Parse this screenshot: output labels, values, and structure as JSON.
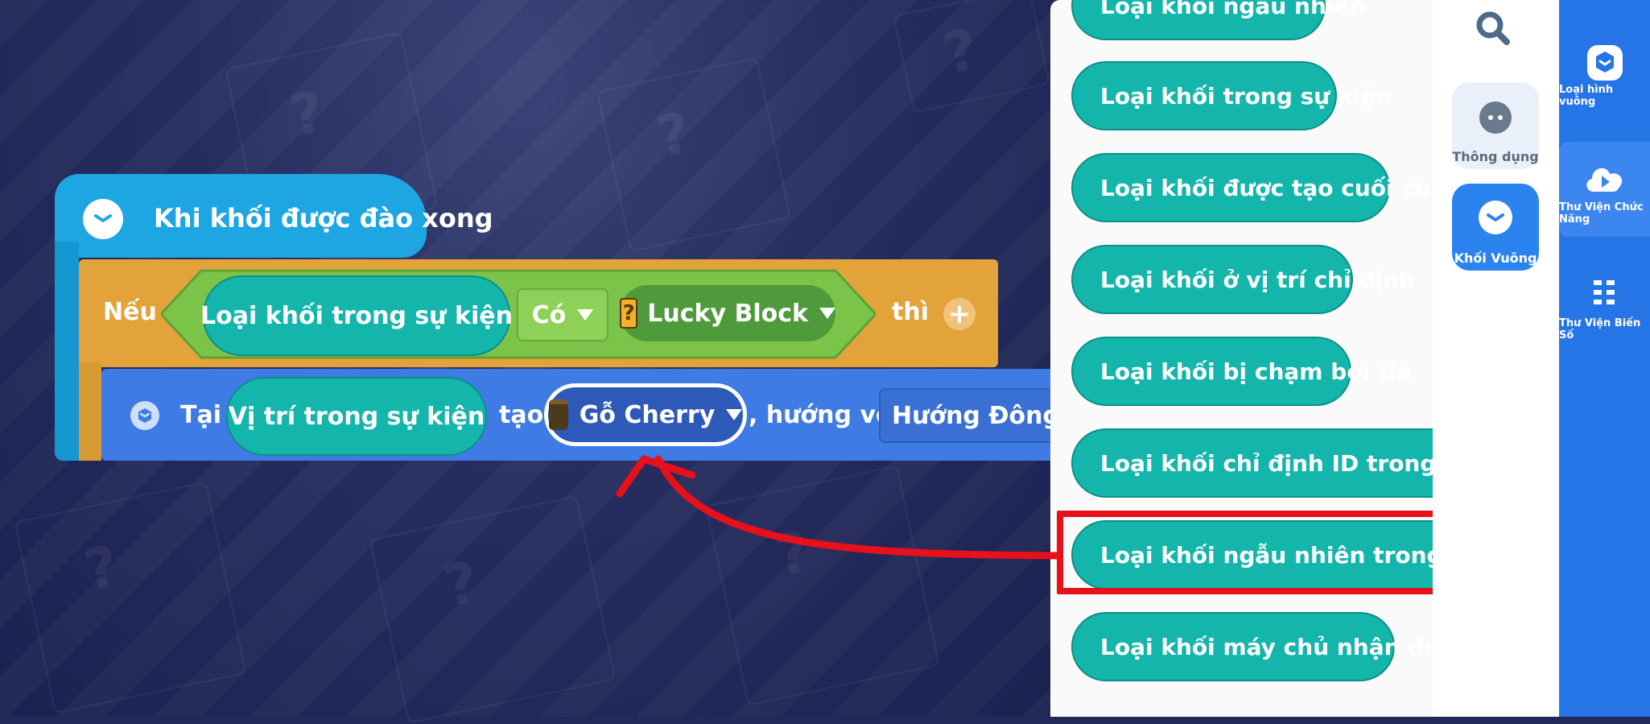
{
  "script": {
    "event_title": "Khi khối được đào xong",
    "if_label": "Nếu",
    "then_label": "thì",
    "plus_symbol": "+",
    "condition": {
      "left_reporter": "Loại khối trong sự kiện",
      "operator": "Có",
      "right_value": "Lucky Block",
      "right_icon": "question-block-icon"
    },
    "action": {
      "at_label": "Tại",
      "position_reporter": "Vị trí trong sự kiện",
      "create_label": "tạo",
      "block_value": "Gỗ Cherry",
      "block_icon": "cherry-log-icon",
      "facing_label": ", hướng về",
      "facing_value": "Hướng Đông"
    }
  },
  "palette": {
    "items": [
      "Loại khối ngẫu nhiên",
      "Loại khối trong sự kiện",
      "Loại khối được tạo cuối cùng",
      "Loại khối ở vị trí chỉ định",
      "Loại khối bị chạm bởi tia",
      "Loại khối chỉ định ID trong nhóm loạ",
      "Loại khối ngẫu nhiên trong nhóm loạ",
      "Loại khối máy chủ nhận được"
    ],
    "highlighted_index": 6
  },
  "categories": {
    "search_icon": "search-icon",
    "items": [
      {
        "label": "Thông dụng",
        "icon": "dots-icon"
      },
      {
        "label": "Khối Vuông",
        "icon": "cube-icon"
      }
    ]
  },
  "rail": {
    "items": [
      {
        "label": "Loại hình vuông",
        "icon": "cube-badge-icon"
      },
      {
        "label": "Thư Viện Chức Năng",
        "icon": "play-cloud-icon"
      },
      {
        "label": "Thư Viện Biến Số",
        "icon": "grid-list-icon"
      }
    ]
  },
  "colors": {
    "event": "#1ea6e3",
    "control": "#e3a33b",
    "operator": "#7cc34a",
    "action": "#3f7be4",
    "reporter": "#14b6ac",
    "annotation": "#e8101a",
    "rail": "#2575e6"
  }
}
